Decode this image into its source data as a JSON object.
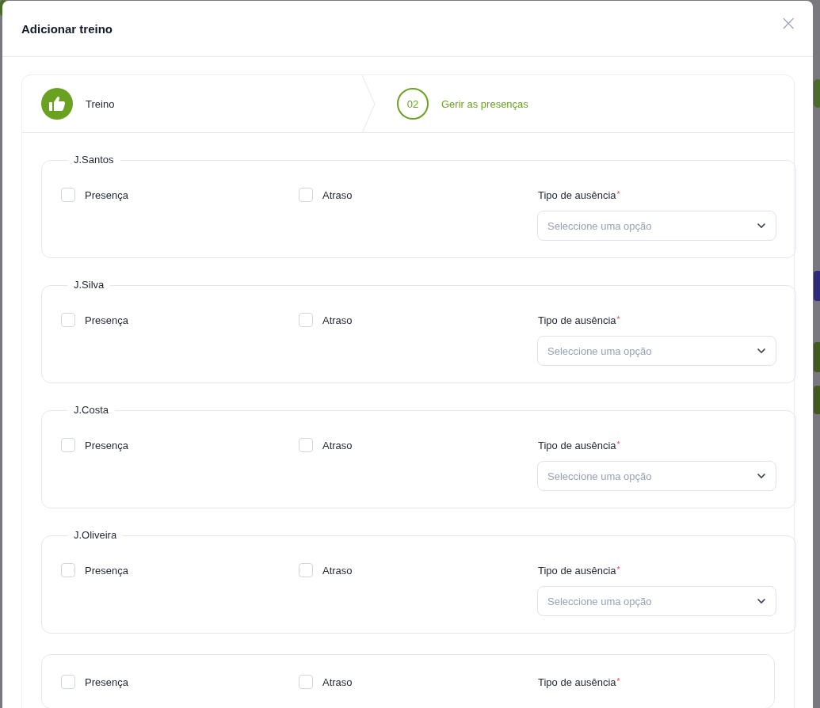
{
  "dialog": {
    "title": "Adicionar treino",
    "close_label": "×"
  },
  "steps": [
    {
      "kind": "done",
      "label": "Treino",
      "selected": false
    },
    {
      "kind": "number",
      "number": "02",
      "label": "Gerir as presenças",
      "selected": true
    }
  ],
  "players": [
    {
      "name": "J.Santos",
      "presence": {
        "label": "Presença",
        "checked": false
      },
      "late": {
        "label": "Atraso",
        "checked": false
      },
      "absence": {
        "label": "Tipo de ausência",
        "required_mark": "*",
        "placeholder": "Seleccione uma opção"
      }
    },
    {
      "name": "J.Silva",
      "presence": {
        "label": "Presença",
        "checked": false
      },
      "late": {
        "label": "Atraso",
        "checked": false
      },
      "absence": {
        "label": "Tipo de ausência",
        "required_mark": "*",
        "placeholder": "Seleccione uma opção"
      }
    },
    {
      "name": "J.Costa",
      "presence": {
        "label": "Presença",
        "checked": false
      },
      "late": {
        "label": "Atraso",
        "checked": false
      },
      "absence": {
        "label": "Tipo de ausência",
        "required_mark": "*",
        "placeholder": "Seleccione uma opção"
      }
    },
    {
      "name": "J.Oliveira",
      "presence": {
        "label": "Presença",
        "checked": false
      },
      "late": {
        "label": "Atraso",
        "checked": false
      },
      "absence": {
        "label": "Tipo de ausência",
        "required_mark": "*",
        "placeholder": "Seleccione uma opção"
      }
    },
    {
      "presence": {
        "label": "Presença",
        "checked": false
      },
      "late": {
        "label": "Atraso",
        "checked": false
      },
      "absence": {
        "label": "Tipo de ausência",
        "required_mark": "*"
      }
    }
  ]
}
